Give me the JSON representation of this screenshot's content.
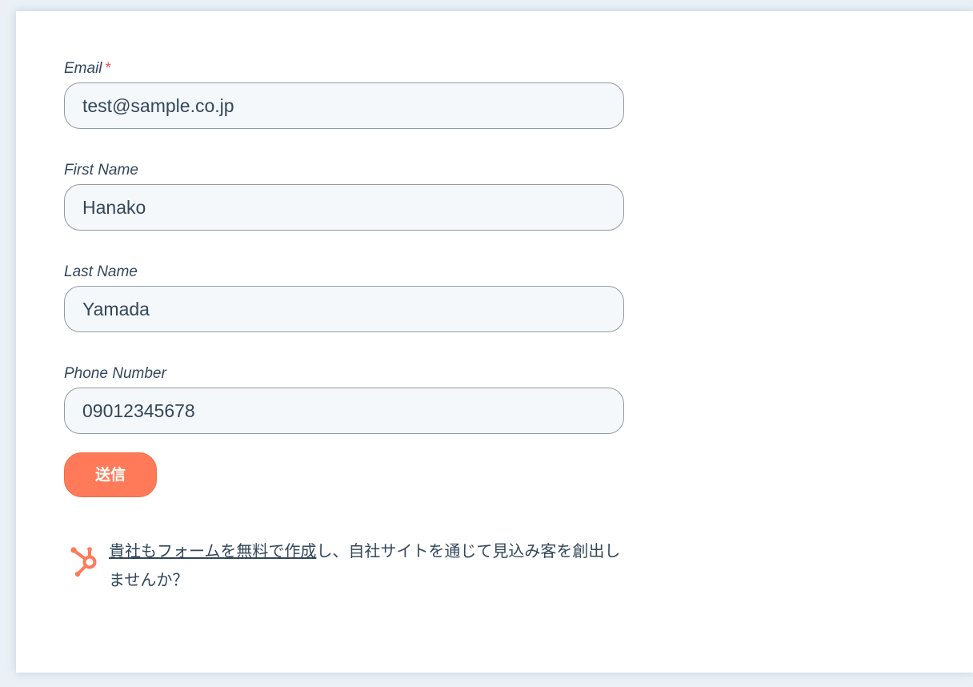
{
  "form": {
    "email": {
      "label": "Email",
      "required_mark": "*",
      "value": "test@sample.co.jp"
    },
    "first_name": {
      "label": "First Name",
      "value": "Hanako"
    },
    "last_name": {
      "label": "Last Name",
      "value": "Yamada"
    },
    "phone": {
      "label": "Phone Number",
      "value": "09012345678"
    },
    "submit_label": "送信"
  },
  "promo": {
    "icon": "hubspot-sprocket-icon",
    "link_text": "貴社もフォームを無料で作成",
    "rest_text": "し、自社サイトを通じて見込み客を創出しませんか？"
  },
  "colors": {
    "accent": "#ff7a59",
    "text": "#33475b",
    "input_bg": "#f5f8fa",
    "required": "#f2545b"
  }
}
